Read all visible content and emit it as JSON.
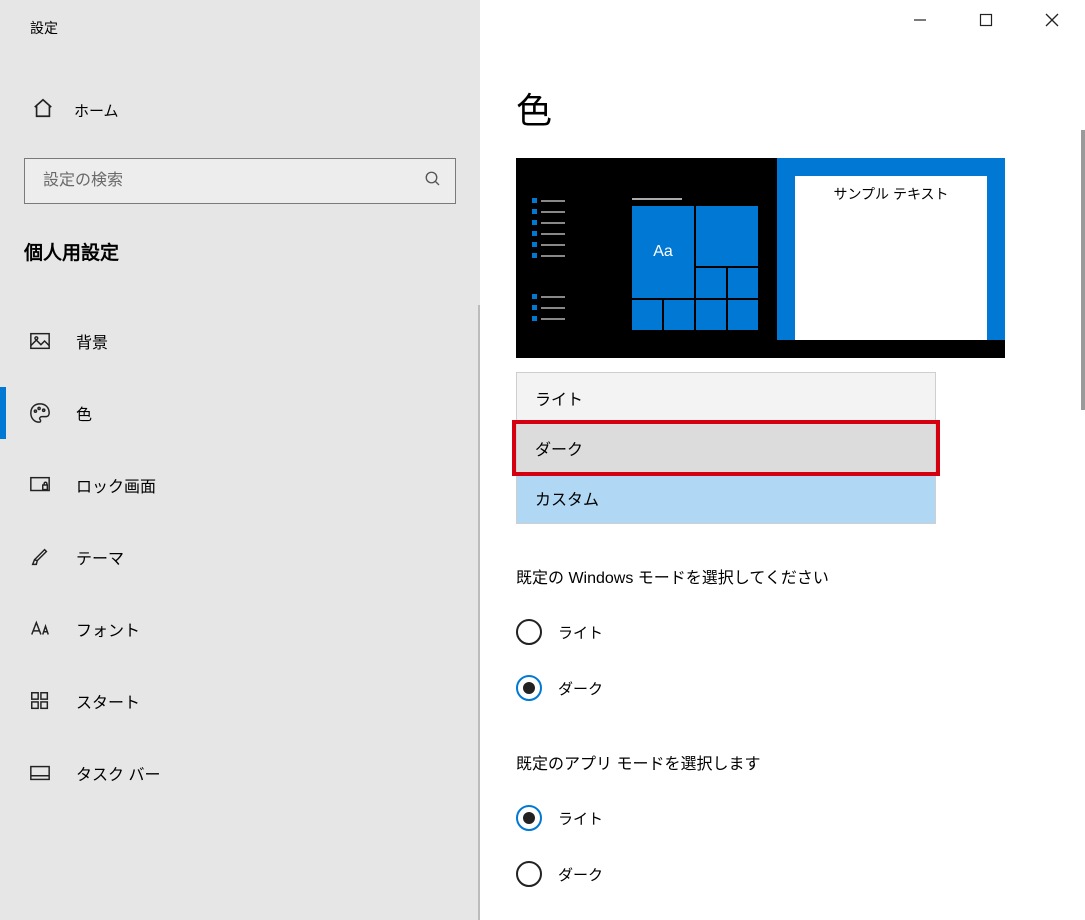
{
  "app": {
    "title": "設定"
  },
  "home": {
    "label": "ホーム"
  },
  "search": {
    "placeholder": "設定の検索"
  },
  "category": {
    "title": "個人用設定"
  },
  "nav": {
    "items": [
      {
        "key": "background",
        "label": "背景"
      },
      {
        "key": "colors",
        "label": "色"
      },
      {
        "key": "lockscreen",
        "label": "ロック画面"
      },
      {
        "key": "themes",
        "label": "テーマ"
      },
      {
        "key": "fonts",
        "label": "フォント"
      },
      {
        "key": "start",
        "label": "スタート"
      },
      {
        "key": "taskbar",
        "label": "タスク バー"
      }
    ],
    "selected": "colors"
  },
  "page": {
    "heading": "色"
  },
  "preview": {
    "sample_text": "サンプル テキスト",
    "tile_text": "Aa"
  },
  "color_dropdown": {
    "options": [
      {
        "key": "light",
        "label": "ライト"
      },
      {
        "key": "dark",
        "label": "ダーク"
      },
      {
        "key": "custom",
        "label": "カスタム"
      }
    ],
    "highlighted": "dark",
    "current": "custom"
  },
  "windows_mode": {
    "label": "既定の Windows モードを選択してください",
    "options": [
      {
        "key": "light",
        "label": "ライト"
      },
      {
        "key": "dark",
        "label": "ダーク"
      }
    ],
    "selected": "dark"
  },
  "app_mode": {
    "label": "既定のアプリ モードを選択します",
    "options": [
      {
        "key": "light",
        "label": "ライト"
      },
      {
        "key": "dark",
        "label": "ダーク"
      }
    ],
    "selected": "light"
  }
}
